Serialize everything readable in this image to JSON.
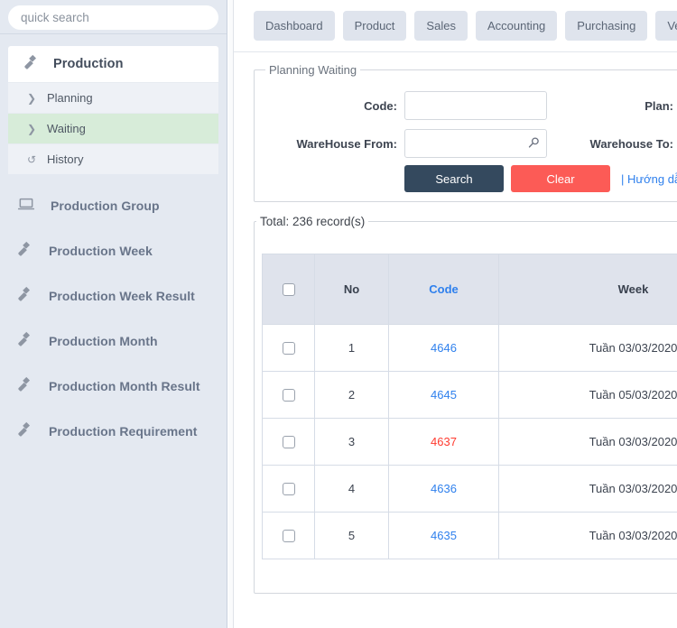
{
  "quick_search": {
    "placeholder": "quick search",
    "value": ""
  },
  "sidebar": {
    "section": {
      "label": "Production",
      "icon": "hammer-icon",
      "children": [
        {
          "label": "Planning",
          "icon": "chevron-right-icon",
          "active": false
        },
        {
          "label": "Waiting",
          "icon": "chevron-right-icon",
          "active": true
        },
        {
          "label": "History",
          "icon": "history-icon",
          "active": false
        }
      ]
    },
    "items": [
      {
        "label": "Production Group",
        "icon": "laptop-icon"
      },
      {
        "label": "Production Week",
        "icon": "hammer-icon"
      },
      {
        "label": "Production Week Result",
        "icon": "hammer-icon"
      },
      {
        "label": "Production Month",
        "icon": "hammer-icon"
      },
      {
        "label": "Production Month Result",
        "icon": "hammer-icon"
      },
      {
        "label": "Production Requirement",
        "icon": "hammer-icon"
      }
    ]
  },
  "tabs": [
    {
      "label": "Dashboard"
    },
    {
      "label": "Product"
    },
    {
      "label": "Sales"
    },
    {
      "label": "Accounting"
    },
    {
      "label": "Purchasing"
    },
    {
      "label": "Ve"
    }
  ],
  "search_panel": {
    "legend": "Planning Waiting",
    "fields": {
      "code_label": "Code:",
      "code_value": "",
      "plan_label": "Plan:",
      "plan_value": "",
      "warehouse_from_label": "WareHouse From:",
      "warehouse_from_value": "",
      "warehouse_from_icon": "search-icon",
      "warehouse_to_label": "Warehouse To:",
      "warehouse_to_value": ""
    },
    "search_button": "Search",
    "clear_button": "Clear",
    "guide_separator": "|",
    "guide_link": "Hướng dẫn sử dụ"
  },
  "results": {
    "total_legend": "Total: 236 record(s)",
    "highlight_color": "#ffff00",
    "columns": [
      {
        "key": "check",
        "label": "",
        "icon": "checkbox-icon"
      },
      {
        "key": "no",
        "label": "No"
      },
      {
        "key": "code",
        "label": "Code",
        "sortable": true
      },
      {
        "key": "week",
        "label": "Week"
      }
    ],
    "rows": [
      {
        "no": "1",
        "code": "4646",
        "code_state": "normal",
        "week": "Tuần 03/03/2020"
      },
      {
        "no": "2",
        "code": "4645",
        "code_state": "normal",
        "week": "Tuần 05/03/2020"
      },
      {
        "no": "3",
        "code": "4637",
        "code_state": "danger",
        "week": "Tuần 03/03/2020"
      },
      {
        "no": "4",
        "code": "4636",
        "code_state": "normal",
        "week": "Tuần 03/03/2020"
      },
      {
        "no": "5",
        "code": "4635",
        "code_state": "normal",
        "week": "Tuần 03/03/2020"
      }
    ]
  },
  "colors": {
    "sidebar_bg": "#e4e9f1",
    "active_item": "#d7ecd9",
    "search_button": "#34495e",
    "clear_button": "#fc5b56",
    "link": "#2f80ed",
    "danger": "#ff3b30",
    "table_header": "#dfe3ec"
  }
}
